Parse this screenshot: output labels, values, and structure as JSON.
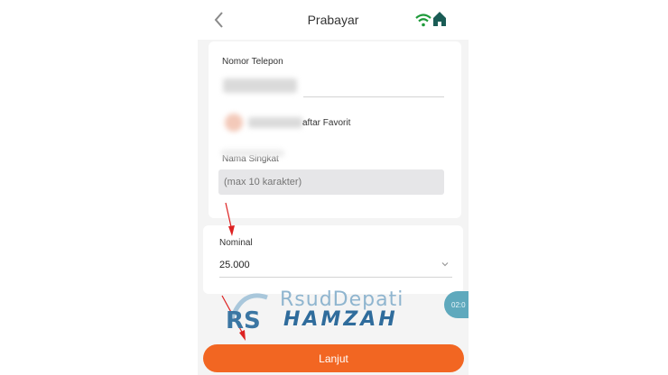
{
  "header": {
    "title": "Prabayar",
    "icons": [
      "back-chevron",
      "wifi-signal",
      "home"
    ]
  },
  "form": {
    "phone_label": "Nomor Telepon",
    "favorite_label": "aftar Favorit",
    "short_name_label": "Nama Singkat",
    "short_name_placeholder": "(max 10 karakter)",
    "nominal_label": "Nominal",
    "nominal_value": "25.000"
  },
  "overlay": {
    "time_badge": "02:0"
  },
  "footer": {
    "continue_label": "Lanjut"
  },
  "watermark": {
    "line1": "RsudDepati",
    "line2": "HAMZAH"
  },
  "colors": {
    "accent": "#f26622",
    "signal": "#1e9a3a",
    "home": "#1a5c55"
  }
}
